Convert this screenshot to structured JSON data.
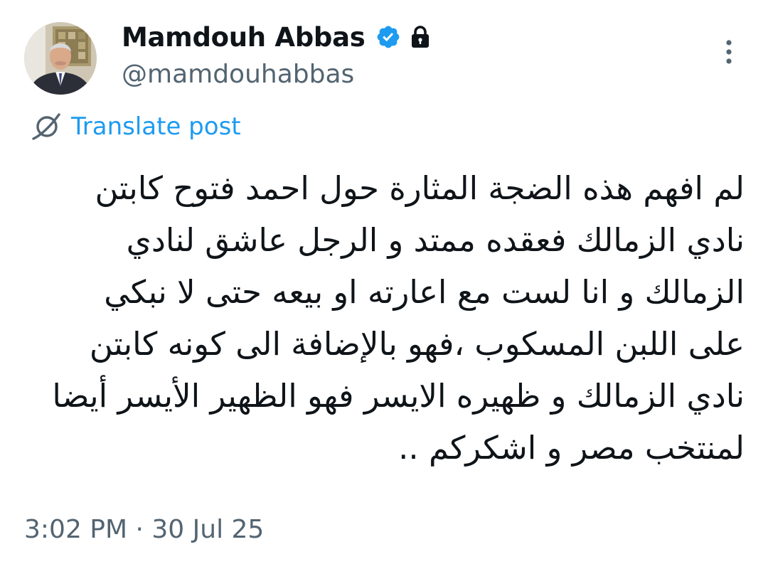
{
  "author": {
    "display_name": "Mamdouh Abbas",
    "handle": "@mamdouhabbas",
    "verified": true,
    "protected": true,
    "avatar": "avatar-photo"
  },
  "icons": {
    "verified": "verified-badge-icon",
    "lock": "lock-icon",
    "more": "more-vertical-icon",
    "translate": "translate-icon"
  },
  "colors": {
    "accent": "#1d9bf0",
    "text": "#0f1419",
    "muted": "#536471"
  },
  "translate": {
    "label": "Translate post"
  },
  "post": {
    "lines": [
      "لم افهم هذه الضجة المثارة حول احمد فتوح كابتن",
      "نادي الزمالك فعقده ممتد و الرجل عاشق لنادي",
      "الزمالك و انا لست مع اعارته او بيعه حتى لا نبكي",
      "على اللبن المسكوب ،فهو بالإضافة الى كونه كابتن",
      "نادي الزمالك و ظهيره الايسر فهو الظهير الأيسر أيضا",
      "لمنتخب مصر و اشكركم .."
    ]
  },
  "meta": {
    "timestamp": "3:02 PM · 30 Jul 25"
  }
}
